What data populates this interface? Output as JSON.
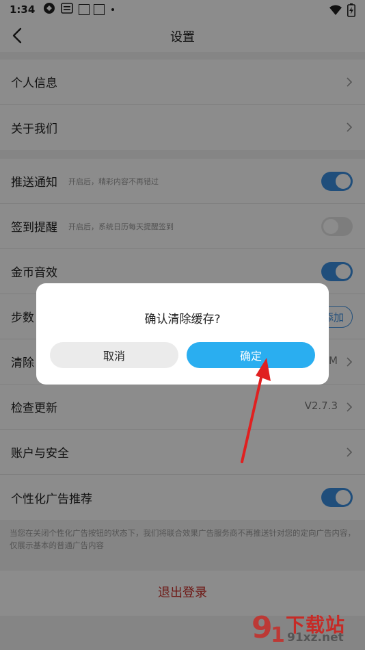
{
  "status_bar": {
    "time": "1:34"
  },
  "header": {
    "title": "设置"
  },
  "group1": {
    "items": [
      {
        "label": "个人信息"
      },
      {
        "label": "关于我们"
      }
    ]
  },
  "group2": {
    "items": [
      {
        "label": "推送通知",
        "hint": "开启后，精彩内容不再错过",
        "toggle": true
      },
      {
        "label": "签到提醒",
        "hint": "开启后，系统日历每天提醒签到",
        "toggle": false
      },
      {
        "label": "金币音效",
        "toggle": true
      },
      {
        "label": "步数",
        "button": "添加"
      },
      {
        "label": "清除",
        "value": "M"
      },
      {
        "label": "检查更新",
        "value": "V2.7.3"
      },
      {
        "label": "账户与安全"
      },
      {
        "label": "个性化广告推荐",
        "toggle": true
      }
    ]
  },
  "ad_note": "当您在关闭个性化广告按钮的状态下，我们将联合效果广告服务商不再推送针对您的定向广告内容，仅展示基本的普通广告内容",
  "logout_label": "退出登录",
  "dialog": {
    "message": "确认清除缓存?",
    "cancel_label": "取消",
    "confirm_label": "确定"
  },
  "watermark": {
    "line1": "下载站",
    "line2": "91xz.net"
  },
  "colors": {
    "accent": "#3b8fe0",
    "confirm": "#2aaef0",
    "logout": "#c8302a",
    "arrow": "#e02020"
  }
}
